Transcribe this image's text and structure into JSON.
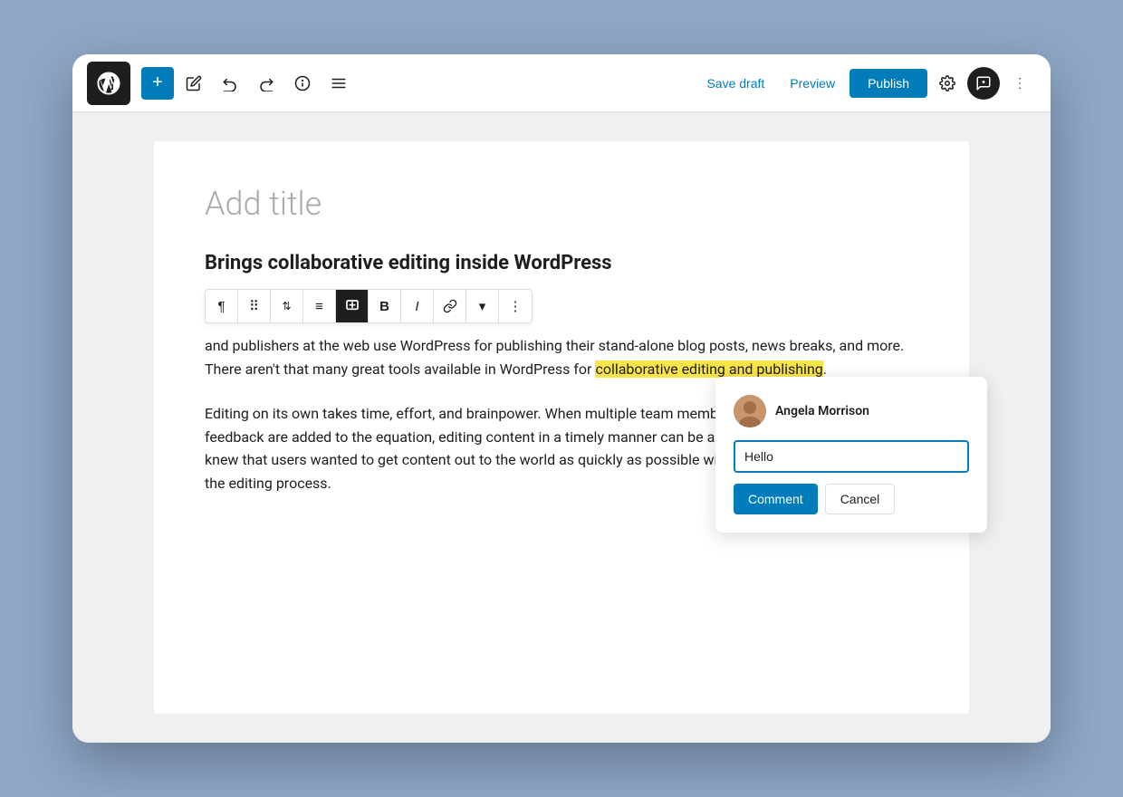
{
  "toolbar": {
    "add_label": "+",
    "save_draft_label": "Save draft",
    "preview_label": "Preview",
    "publish_label": "Publish"
  },
  "editor": {
    "title_placeholder": "Add title",
    "heading": "Brings collaborative editing inside WordPress",
    "partial_text": "and publishers at the web use WordPress for publishing their stand-alone blog posts, news breaks, and more. There aren't that many great tools available in WordPress for",
    "highlighted_text": "collaborative editing and publishing",
    "paragraph": "Editing on its own takes time, effort, and brainpower. When multiple team members and their constant feedback are added to the equation, editing content in a timely manner can be almost impossible to do. We knew that users wanted to get content out to the world as quickly as possible without having to spend eons on the editing process."
  },
  "block_toolbar": {
    "buttons": [
      "¶",
      "⠿",
      "⇅",
      "≡",
      "✚",
      "B",
      "I",
      "🔗",
      "▾",
      "⋮"
    ]
  },
  "comment": {
    "author": "Angela Morrison",
    "input_value": "Hello",
    "input_placeholder": "",
    "comment_btn": "Comment",
    "cancel_btn": "Cancel"
  }
}
